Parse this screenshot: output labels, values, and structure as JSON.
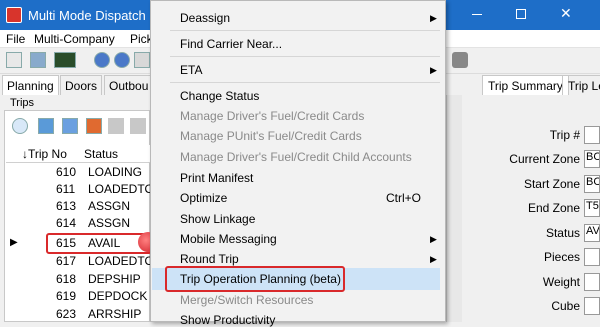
{
  "window": {
    "title": "Multi Mode Dispatch @"
  },
  "menubar": {
    "items": [
      "File",
      "Multi-Company",
      "Pick"
    ]
  },
  "tabs": [
    "Planning",
    "Doors",
    "Outbou"
  ],
  "trips": {
    "label": "Trips",
    "columns": [
      "Trip No",
      "Status"
    ],
    "rows": [
      {
        "no": "610",
        "status": "LOADING"
      },
      {
        "no": "611",
        "status": "LOADEDTO"
      },
      {
        "no": "613",
        "status": "ASSGN"
      },
      {
        "no": "614",
        "status": "ASSGN"
      },
      {
        "no": "615",
        "status": "AVAIL"
      },
      {
        "no": "617",
        "status": "LOADEDTO"
      },
      {
        "no": "618",
        "status": "DEPSHIP"
      },
      {
        "no": "619",
        "status": "DEPDOCK"
      },
      {
        "no": "623",
        "status": "ARRSHIP"
      }
    ]
  },
  "context_menu": {
    "items": [
      {
        "label": "Deassign",
        "submenu": true
      },
      {
        "label": "Find Carrier Near..."
      },
      {
        "label": "ETA",
        "submenu": true
      },
      {
        "label": "Change Status"
      },
      {
        "label": "Manage Driver's Fuel/Credit Cards",
        "disabled": true
      },
      {
        "label": "Manage PUnit's Fuel/Credit Cards",
        "disabled": true
      },
      {
        "label": "Manage Driver's Fuel/Credit Child Accounts",
        "disabled": true
      },
      {
        "label": "Print Manifest"
      },
      {
        "label": "Optimize",
        "shortcut": "Ctrl+O"
      },
      {
        "label": "Show Linkage"
      },
      {
        "label": "Mobile Messaging",
        "submenu": true
      },
      {
        "label": "Round Trip",
        "submenu": true
      },
      {
        "label": "Trip Operation Planning (beta)",
        "highlighted": true
      },
      {
        "label": "Merge/Switch Resources",
        "disabled": true
      },
      {
        "label": "Show Productivity"
      }
    ]
  },
  "right_panel": {
    "tabs": [
      "Trip Summary",
      "Trip Le"
    ],
    "fields": [
      {
        "label": "Trip #",
        "value": ""
      },
      {
        "label": "Current Zone",
        "value": "BC"
      },
      {
        "label": "Start Zone",
        "value": "BC"
      },
      {
        "label": "End Zone",
        "value": "T5"
      },
      {
        "label": "Status",
        "value": "AV"
      },
      {
        "label": "Pieces",
        "value": ""
      },
      {
        "label": "Weight",
        "value": ""
      },
      {
        "label": "Cube",
        "value": ""
      }
    ]
  }
}
